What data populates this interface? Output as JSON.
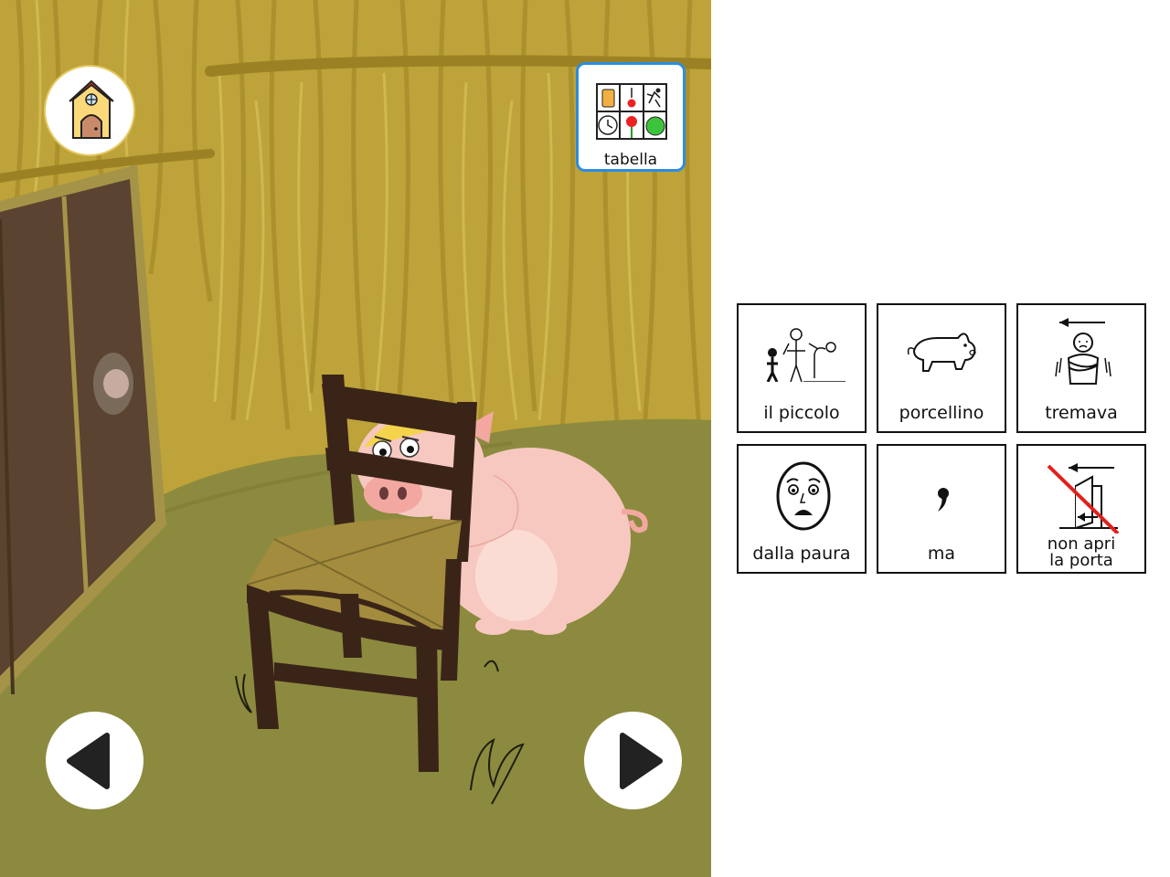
{
  "toolbar": {
    "home_icon": "house-icon",
    "tabella_label": "tabella",
    "tabella_icon": "symbol-board-icon",
    "prev_icon": "triangle-left-icon",
    "next_icon": "triangle-right-icon"
  },
  "symbols": [
    {
      "label": "il piccolo",
      "icon": "small-person-icon"
    },
    {
      "label": "porcellino",
      "icon": "pig-icon"
    },
    {
      "label": "tremava",
      "icon": "shivering-person-icon"
    },
    {
      "label": "dalla paura",
      "icon": "scared-face-icon"
    },
    {
      "label": "ma",
      "icon": "comma-icon"
    },
    {
      "label": "non apri",
      "label2": "la porta",
      "icon": "not-open-door-icon"
    }
  ],
  "colors": {
    "straw_wall": "#bda339",
    "grass_floor": "#8c8a3e",
    "door": "#5a4330",
    "chair": "#3a2418",
    "pig": "#f7c8c0",
    "tabella_border": "#2a8de0",
    "home_border": "#e6c860"
  }
}
